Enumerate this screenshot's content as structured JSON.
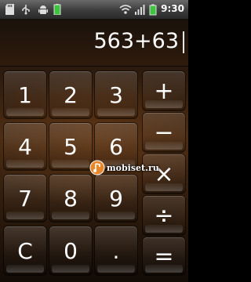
{
  "status_bar": {
    "time": "9:30",
    "icons": [
      "sd-card-icon",
      "usb-icon",
      "android-debug-icon",
      "battery-charging-icon",
      "wifi-icon",
      "signal-icon",
      "battery-icon"
    ]
  },
  "display": {
    "expression": "563+63"
  },
  "keypad": {
    "digits": [
      "1",
      "2",
      "3",
      "4",
      "5",
      "6",
      "7",
      "8",
      "9",
      "C",
      "0",
      "."
    ],
    "operators": [
      "+",
      "−",
      "×",
      "÷",
      "="
    ]
  },
  "watermark": {
    "text": "mobiset.ru"
  },
  "colors": {
    "accent": "#e8862a",
    "background": "#3a220f"
  }
}
